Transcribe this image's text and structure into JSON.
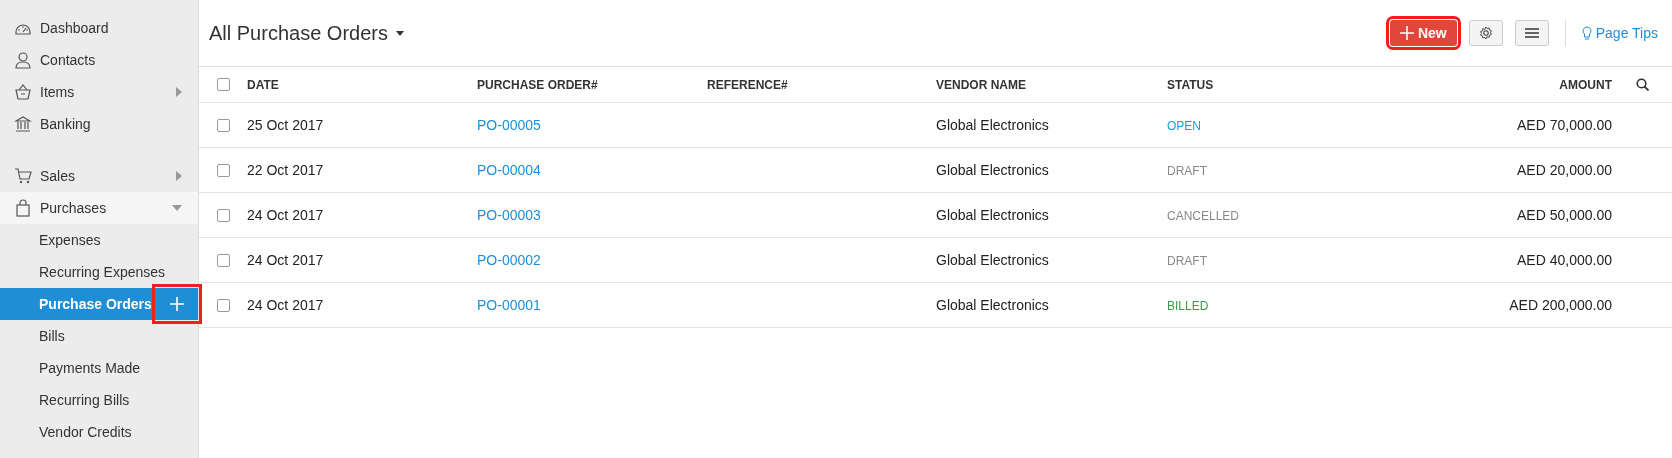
{
  "sidebar": {
    "groups": [
      {
        "items": [
          {
            "label": "Dashboard"
          },
          {
            "label": "Contacts"
          },
          {
            "label": "Items",
            "expanded": false
          },
          {
            "label": "Banking"
          }
        ]
      },
      {
        "items": [
          {
            "label": "Sales",
            "expanded": false
          },
          {
            "label": "Purchases",
            "expanded": true,
            "children": [
              {
                "label": "Expenses",
                "selected": false
              },
              {
                "label": "Recurring Expenses",
                "selected": false
              },
              {
                "label": "Purchase Orders",
                "selected": true,
                "add_highlighted": true
              },
              {
                "label": "Bills",
                "selected": false
              },
              {
                "label": "Payments Made",
                "selected": false
              },
              {
                "label": "Recurring Bills",
                "selected": false
              },
              {
                "label": "Vendor Credits",
                "selected": false
              }
            ]
          }
        ]
      }
    ]
  },
  "header": {
    "title": "All Purchase Orders",
    "new_button": {
      "label": "New",
      "highlighted": true
    },
    "page_tips": "Page Tips"
  },
  "table": {
    "select_all_checked": false,
    "columns": [
      "DATE",
      "PURCHASE ORDER#",
      "REFERENCE#",
      "VENDOR NAME",
      "STATUS",
      "AMOUNT"
    ],
    "rows": [
      {
        "date": "25 Oct 2017",
        "order": "PO-00005",
        "vendor": "Global Electronics",
        "status": "OPEN",
        "color": "#1b9ad6",
        "amount": "AED 70,000.00",
        "checked": false
      },
      {
        "date": "22 Oct 2017",
        "order": "PO-00004",
        "vendor": "Global Electronics",
        "status": "DRAFT",
        "color": "#888888",
        "amount": "AED 20,000.00",
        "checked": false
      },
      {
        "date": "24 Oct 2017",
        "order": "PO-00003",
        "vendor": "Global Electronics",
        "status": "CANCELLED",
        "color": "#888888",
        "amount": "AED 50,000.00",
        "checked": false
      },
      {
        "date": "24 Oct 2017",
        "order": "PO-00002",
        "vendor": "Global Electronics",
        "status": "DRAFT",
        "color": "#888888",
        "amount": "AED 40,000.00",
        "checked": false
      },
      {
        "date": "24 Oct 2017",
        "order": "PO-00001",
        "vendor": "Global Electronics",
        "status": "BILLED",
        "color": "#3b9a45",
        "amount": "AED 200,000.00",
        "checked": false
      }
    ]
  }
}
